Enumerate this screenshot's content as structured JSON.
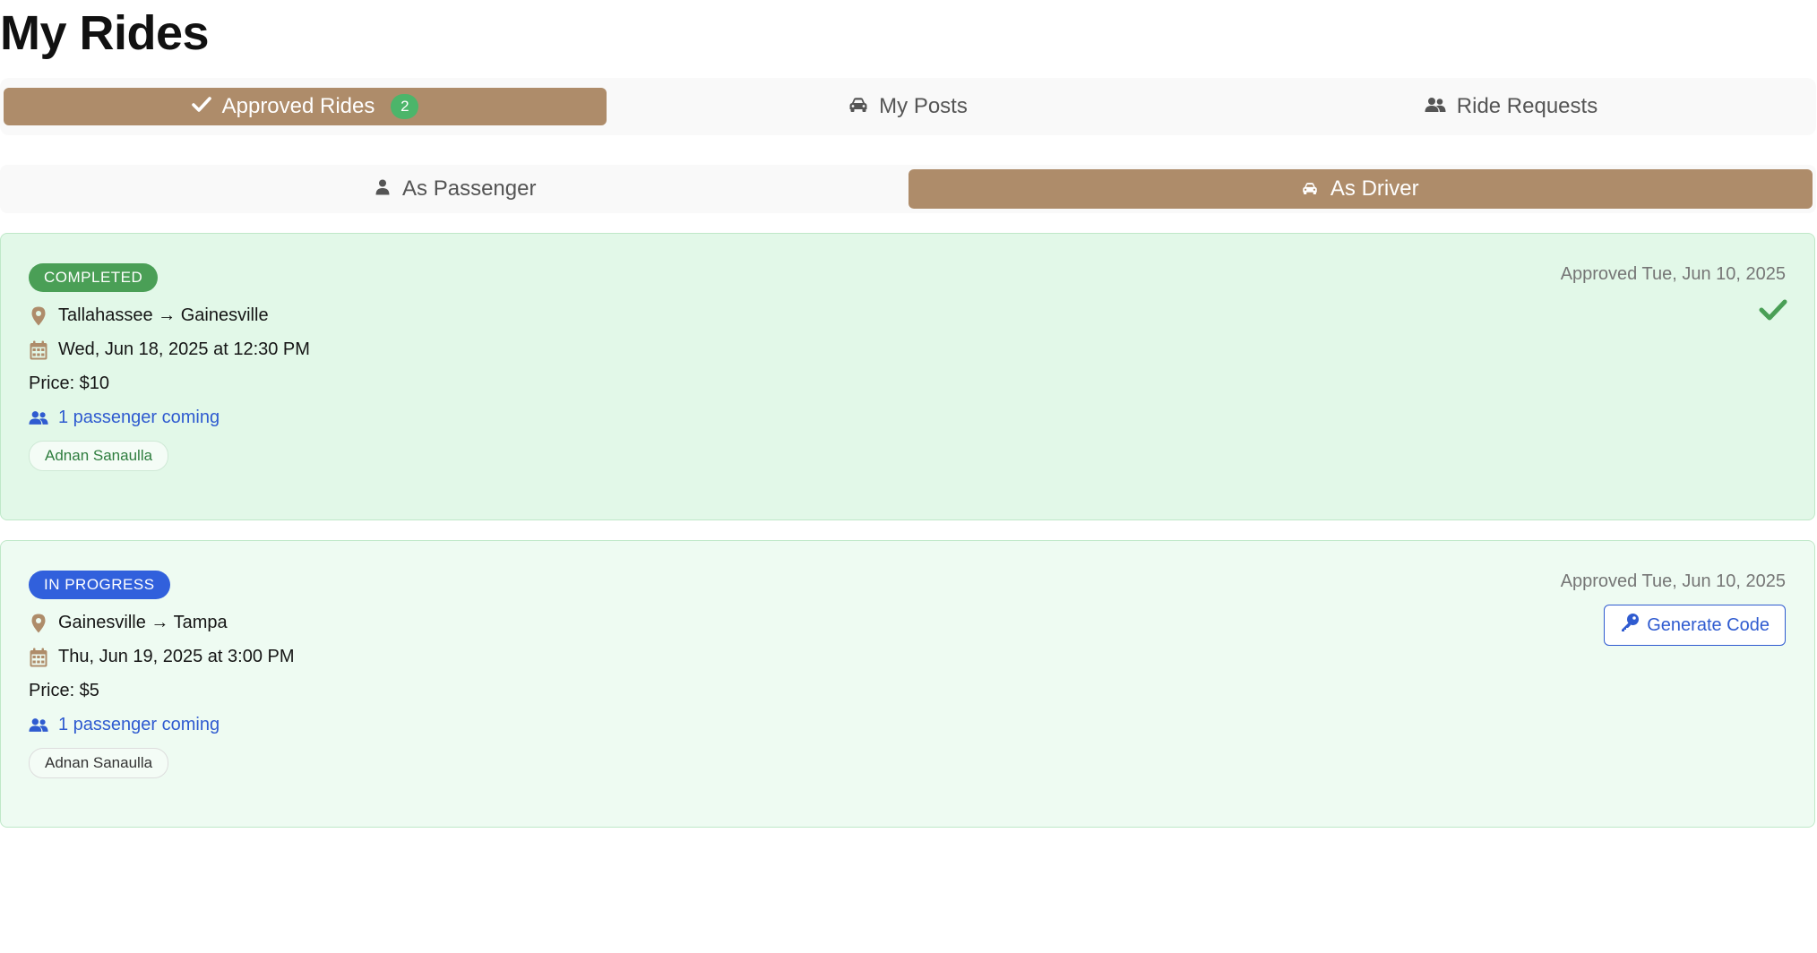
{
  "page": {
    "title": "My Rides"
  },
  "colors": {
    "accent": "#ae8c6a",
    "badge_green": "#4cb56a",
    "completed_badge": "#4a9f56",
    "in_progress_badge": "#3160dc",
    "link_blue": "#2f5bd0",
    "completed_card_bg": "#e2f8e8",
    "in_progress_card_bg": "#eefbf2"
  },
  "main_tabs": [
    {
      "label": "Approved Rides",
      "icon": "check-icon",
      "badge": "2",
      "active": true
    },
    {
      "label": "My Posts",
      "icon": "car-icon",
      "active": false
    },
    {
      "label": "Ride Requests",
      "icon": "users-icon",
      "active": false
    }
  ],
  "sub_tabs": [
    {
      "label": "As Passenger",
      "icon": "user-icon",
      "active": false
    },
    {
      "label": "As Driver",
      "icon": "car-icon",
      "active": true
    }
  ],
  "rides": [
    {
      "status": "COMPLETED",
      "route": "Tallahassee → Gainesville",
      "datetime": "Wed, Jun 18, 2025 at 12:30 PM",
      "price": "Price: $10",
      "passengers": "1 passenger coming",
      "passenger_names": [
        "Adnan Sanaulla"
      ],
      "approved": "Approved Tue, Jun 10, 2025",
      "action_icon": "check-icon"
    },
    {
      "status": "IN PROGRESS",
      "route": "Gainesville → Tampa",
      "datetime": "Thu, Jun 19, 2025 at 3:00 PM",
      "price": "Price: $5",
      "passengers": "1 passenger coming",
      "passenger_names": [
        "Adnan Sanaulla"
      ],
      "approved": "Approved Tue, Jun 10, 2025",
      "action_label": "Generate Code",
      "action_icon": "key-icon"
    }
  ]
}
